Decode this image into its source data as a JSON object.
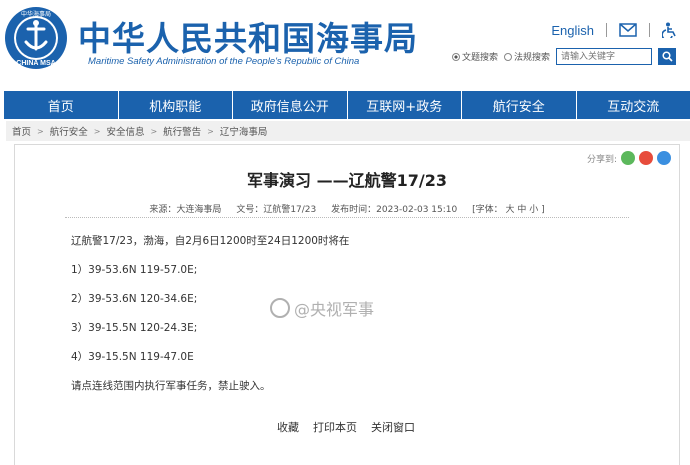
{
  "header": {
    "logo_text": "CHINA MSA",
    "logo_top": "中华海事局",
    "title": "中华人民共和国海事局",
    "subtitle": "Maritime Safety Administration of the People's Republic of China",
    "lang": "English",
    "search": {
      "option1": "文题搜索",
      "option2": "法规搜索",
      "placeholder": "请输入关键字"
    }
  },
  "nav": {
    "items": [
      "首页",
      "机构职能",
      "政府信息公开",
      "互联网+政务",
      "航行安全",
      "互动交流"
    ]
  },
  "breadcrumb": [
    "首页",
    "航行安全",
    "安全信息",
    "航行警告",
    "辽宁海事局"
  ],
  "article": {
    "share_label": "分享到:",
    "title": "军事演习 ——辽航警17/23",
    "meta": {
      "source": "来源：大连海事局",
      "doc_no": "文号：辽航警17/23",
      "publish": "发布时间：2023-02-03 15:10",
      "font": "[字体： 大  中  小 ]"
    },
    "paragraphs": [
      "辽航警17/23，渤海，自2月6日1200时至24日1200时将在",
      "1）39-53.6N    119-57.0E;",
      "2）39-53.6N    120-34.6E;",
      "3）39-15.5N    120-24.3E;",
      "4）39-15.5N    119-47.0E",
      "请点连线范围内执行军事任务，禁止驶入。"
    ],
    "actions": [
      "收藏",
      "打印本页",
      "关闭窗口"
    ]
  },
  "watermark": "@央视军事",
  "colors": {
    "brand": "#1b62ad"
  }
}
